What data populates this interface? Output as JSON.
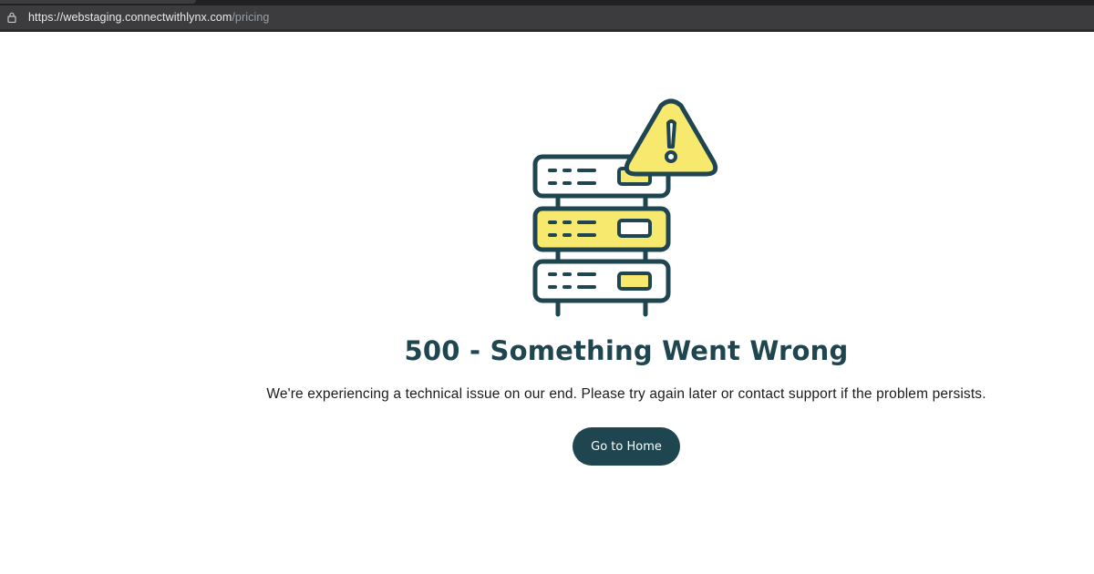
{
  "browser": {
    "url_host": "https://webstaging.connectwithlynx.com",
    "url_path": "/pricing",
    "lock_icon": "lock-icon"
  },
  "error_page": {
    "illustration": "server-warning-icon",
    "title": "500 - Something Went Wrong",
    "description": "We're experiencing a technical issue on our end. Please try again later or contact support if the problem persists.",
    "button_label": "Go to Home"
  },
  "colors": {
    "primary": "#1f4550",
    "accent_yellow": "#f7e96e",
    "background": "#ffffff",
    "browser_bar": "#3c3c3f"
  }
}
